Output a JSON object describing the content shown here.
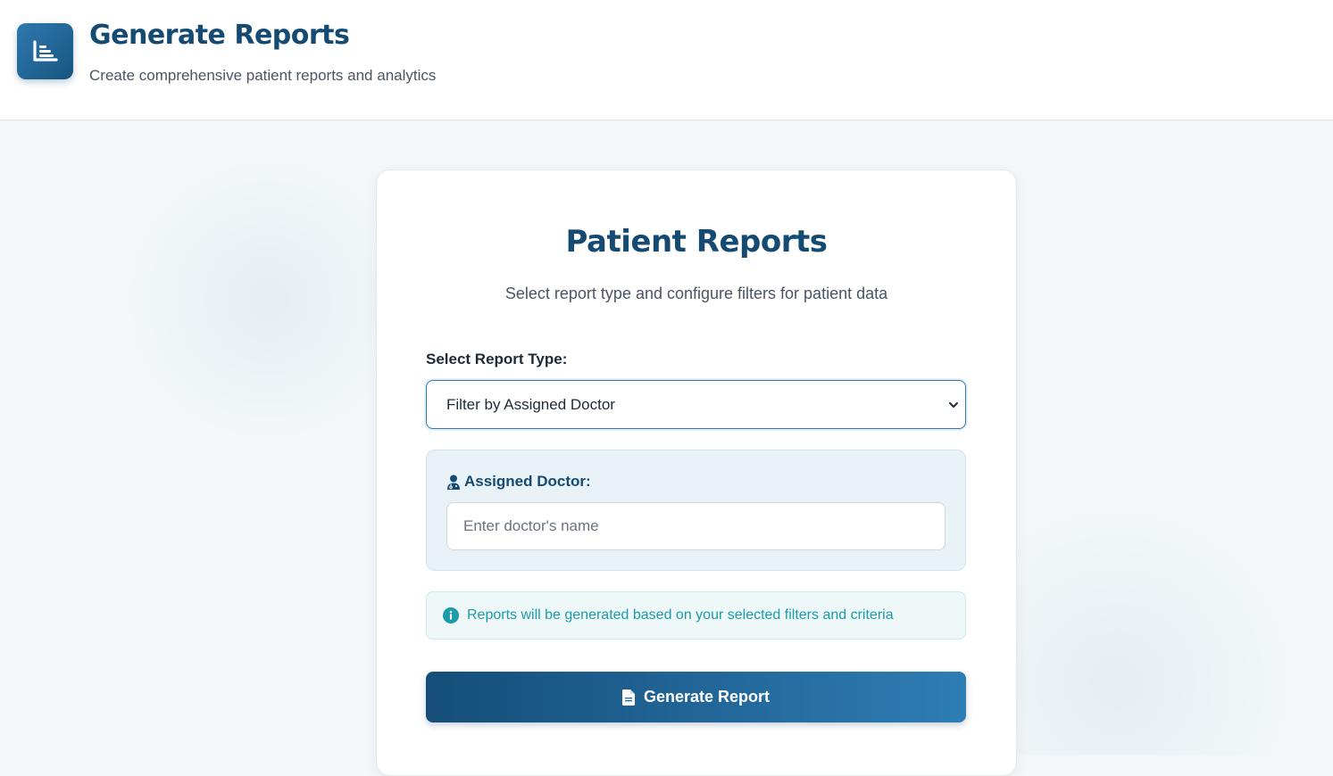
{
  "header": {
    "title": "Generate Reports",
    "subtitle": "Create comprehensive patient reports and analytics",
    "logo_icon": "chart-bar-icon"
  },
  "card": {
    "title": "Patient Reports",
    "subtitle": "Select report type and configure filters for patient data"
  },
  "report_type": {
    "label": "Select Report Type:",
    "selected": "Filter by Assigned Doctor"
  },
  "doctor_filter": {
    "label": "Assigned Doctor:",
    "icon": "user-doctor-icon",
    "placeholder": "Enter doctor's name",
    "value": ""
  },
  "info": {
    "icon": "info-circle-icon",
    "text": "Reports will be generated based on your selected filters and criteria"
  },
  "generate_button": {
    "label": "Generate Report",
    "icon": "file-icon"
  },
  "colors": {
    "primary": "#154b73",
    "accent": "#2e79b0",
    "info": "#1b9aaa",
    "background": "#f3f7f9"
  }
}
